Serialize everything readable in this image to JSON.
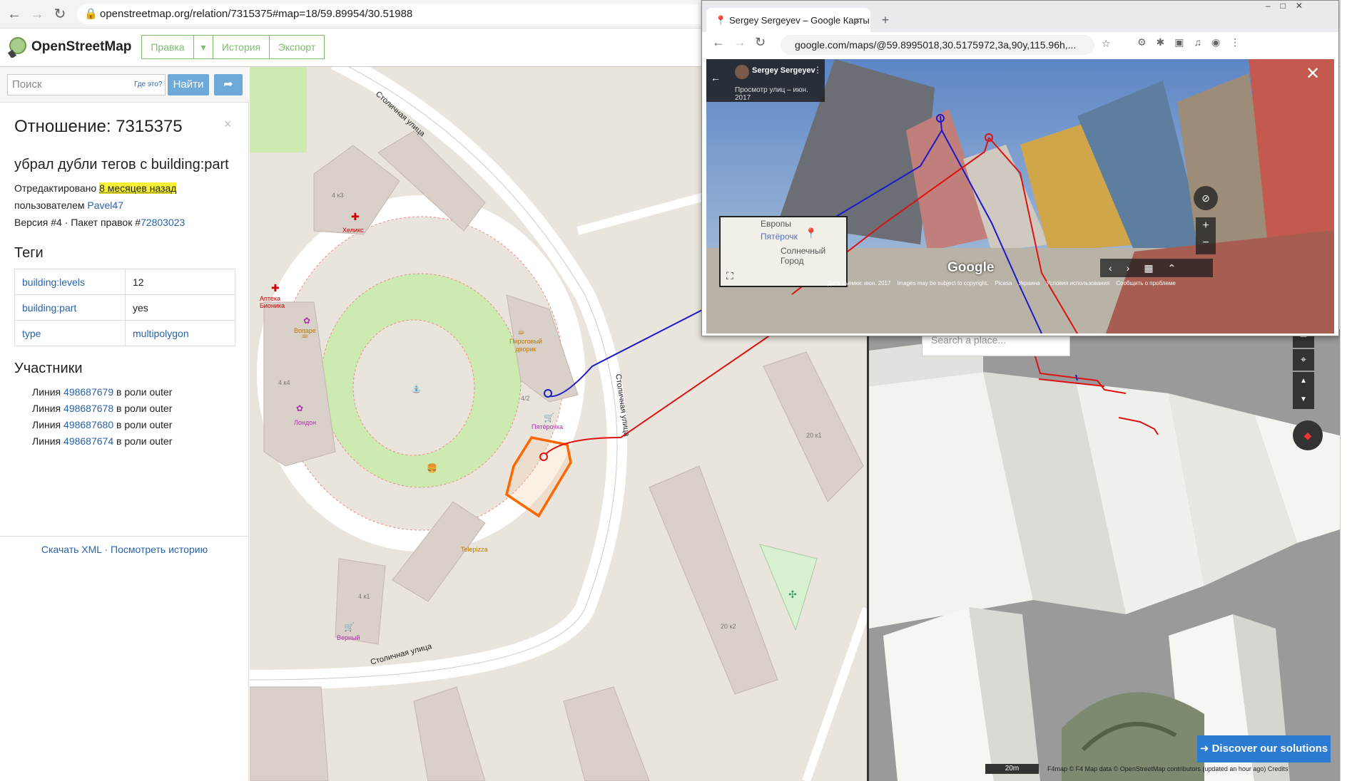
{
  "browser": {
    "url": "openstreetmap.org/relation/7315375#map=18/59.89954/30.51988"
  },
  "osm": {
    "logo": "OpenStreetMap",
    "tabs": {
      "edit": "Правка",
      "history": "История",
      "export": "Экспорт"
    },
    "search": {
      "placeholder": "Поиск",
      "where": "Где это?",
      "button": "Найти"
    },
    "relation_title": "Отношение: 7315375",
    "comment": "убрал дубли тегов с building:part",
    "edited_prefix": "Отредактировано",
    "edited_ago": "8 месяцев назад",
    "by_prefix": "пользователем",
    "user": "Pavel47",
    "version": "Версия #4 · Пакет правок #",
    "changeset": "72803023",
    "tags_title": "Теги",
    "tags": [
      {
        "key": "building:levels",
        "value": "12"
      },
      {
        "key": "building:part",
        "value": "yes"
      },
      {
        "key": "type",
        "value": "multipolygon"
      }
    ],
    "members_title": "Участники",
    "members": [
      {
        "prefix": "Линия",
        "id": "498687679",
        "suffix": "в роли outer"
      },
      {
        "prefix": "Линия",
        "id": "498687678",
        "suffix": "в роли outer"
      },
      {
        "prefix": "Линия",
        "id": "498687680",
        "suffix": "в роли outer"
      },
      {
        "prefix": "Линия",
        "id": "498687674",
        "suffix": "в роли outer"
      }
    ],
    "download_xml": "Скачать XML",
    "sep": "·",
    "view_history": "Посмотреть историю"
  },
  "map_labels": {
    "street1": "Столичная улица",
    "street2": "Столичная улица",
    "street3": "Столичная улица",
    "b1": "4 к3",
    "helix": "Хеликс",
    "apteka": "Аптека Бионика",
    "vopare": "Вопаре",
    "b2": "4 к4",
    "london": "Лондон",
    "pirog": "Пироговый дворик",
    "b42": "4/2",
    "pyat": "Пятёрочка",
    "telepizza": "Telepizza",
    "b41": "4 к1",
    "verny": "Верный",
    "b20k1": "20 к1",
    "b20k2": "20 к2"
  },
  "gmaps_popup": {
    "tab_title": "Sergey Sergeyev – Google Карты",
    "url": "google.com/maps/@59.8995018,30.5175972,3a,90y,115.96h,...",
    "user": "Sergey Sergeyev",
    "sv_info": "Просмотр улиц – июн. 2017",
    "minimap_a": "Европы",
    "minimap_b": "Пятёрочк",
    "minimap_c": "Солнечный Город",
    "google": "Google",
    "footer": [
      "Дата съемки: июн. 2017",
      "Images may be subject to copyright.",
      "Picasa",
      "Украина",
      "Условия использования",
      "Сообщить о проблеме"
    ]
  },
  "f4": {
    "search_placeholder": "Search a place...",
    "discover": "Discover our solutions",
    "scale": "20m",
    "attribution": "F4map © F4   Map data © OpenStreetMap contributors (updated an hour ago)   Credits"
  }
}
